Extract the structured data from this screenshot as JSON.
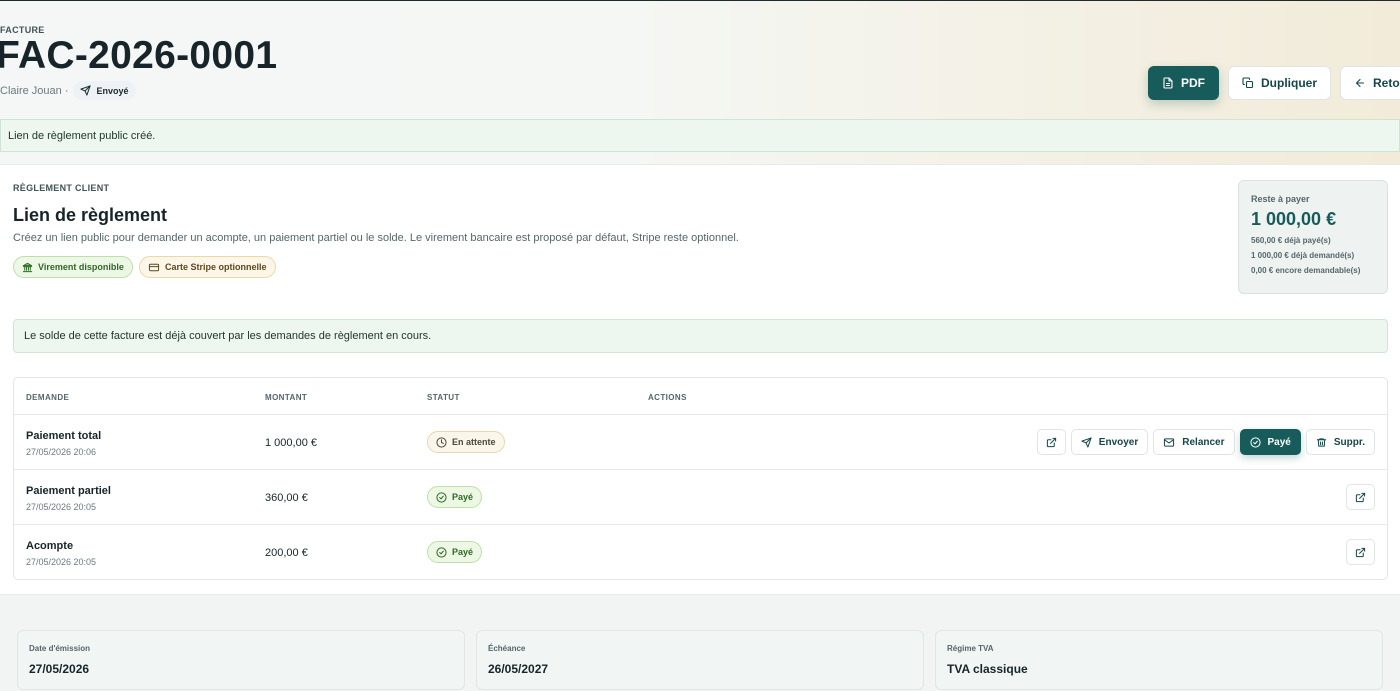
{
  "header": {
    "kicker": "FACTURE",
    "invoice_number": "FAC-2026-0001",
    "client": "Claire Jouan ·",
    "status": "Envoyé",
    "buttons": {
      "pdf": "PDF",
      "duplicate": "Dupliquer",
      "back": "Retour"
    }
  },
  "notice_top": "Lien de règlement public créé.",
  "payment_section": {
    "label": "RÈGLEMENT CLIENT",
    "title": "Lien de règlement",
    "description": "Créez un lien public pour demander un acompte, un paiement partiel ou le solde. Le virement bancaire est proposé par défaut, Stripe reste optionnel.",
    "chips": {
      "transfer": "Virement disponible",
      "stripe": "Carte Stripe optionnelle"
    },
    "summary": {
      "label": "Reste à payer",
      "amount": "1 000,00 €",
      "paid": "560,00 € déjà payé(s)",
      "requested": "1 000,00 € déjà demandé(s)",
      "remaining": "0,00 € encore demandable(s)"
    },
    "notice": "Le solde de cette facture est déjà couvert par les demandes de règlement en cours."
  },
  "table": {
    "columns": [
      "DEMANDE",
      "MONTANT",
      "STATUT",
      "ACTIONS"
    ],
    "rows": [
      {
        "title": "Paiement total",
        "date": "27/05/2026 20:06",
        "amount": "1 000,00 €",
        "status": "En attente"
      },
      {
        "title": "Paiement partiel",
        "date": "27/05/2026 20:05",
        "amount": "360,00 €",
        "status": "Payé"
      },
      {
        "title": "Acompte",
        "date": "27/05/2026 20:05",
        "amount": "200,00 €",
        "status": "Payé"
      }
    ],
    "actions": {
      "send": "Envoyer",
      "remind": "Relancer",
      "paid": "Payé",
      "delete": "Suppr."
    }
  },
  "details": [
    {
      "label": "Date d'émission",
      "value": "27/05/2026"
    },
    {
      "label": "Échéance",
      "value": "26/05/2027"
    },
    {
      "label": "Régime TVA",
      "value": "TVA classique"
    }
  ],
  "colors": {
    "accent": "#175c5b",
    "success_bg": "#edf6ef",
    "paid_badge": "#2f6a24",
    "pending_badge": "#fbf6ea"
  }
}
